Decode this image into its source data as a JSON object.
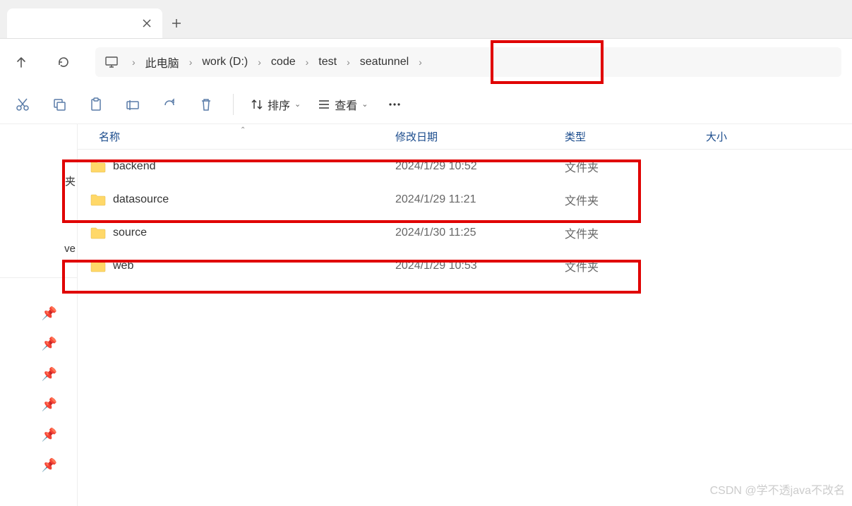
{
  "breadcrumb": {
    "root": "此电脑",
    "items": [
      "work (D:)",
      "code",
      "test",
      "seatunnel"
    ]
  },
  "toolbar": {
    "sort": "排序",
    "view": "查看"
  },
  "sidebar": {
    "item0": "夹",
    "item1": "ve"
  },
  "columns": {
    "name": "名称",
    "date": "修改日期",
    "type": "类型",
    "size": "大小"
  },
  "files": [
    {
      "name": "backend",
      "date": "2024/1/29 10:52",
      "type": "文件夹"
    },
    {
      "name": "datasource",
      "date": "2024/1/29 11:21",
      "type": "文件夹"
    },
    {
      "name": "source",
      "date": "2024/1/30 11:25",
      "type": "文件夹"
    },
    {
      "name": "web",
      "date": "2024/1/29 10:53",
      "type": "文件夹"
    }
  ],
  "watermark": "CSDN @学不透java不改名"
}
